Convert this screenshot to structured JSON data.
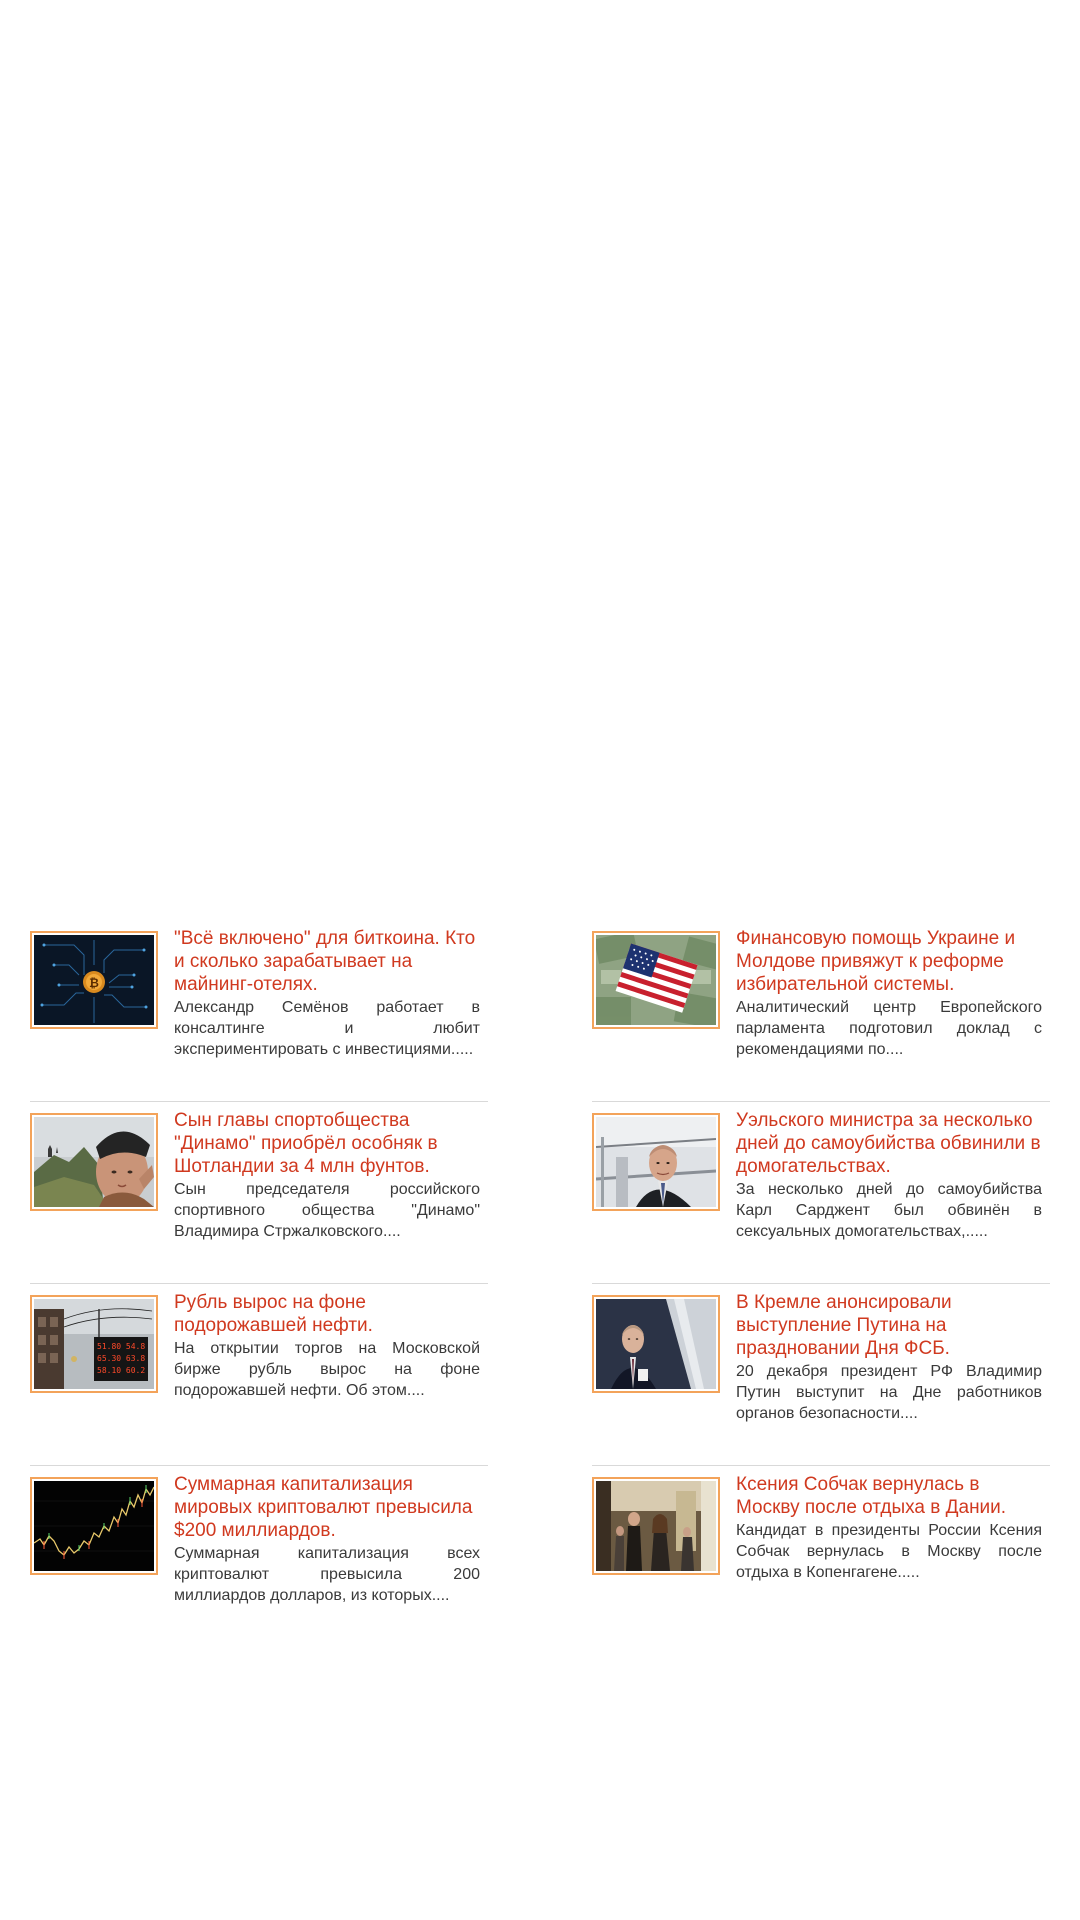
{
  "articles": [
    {
      "title": "\"Всё включено\" для биткоина. Кто и сколько зарабатывает на майнинг-отелях.",
      "excerpt": "Александр Семёнов работает в консалтинге и любит экспериментировать с инвестициями.....",
      "image": "bitcoin-circuit-image"
    },
    {
      "title": "Финансовую помощь Украине и Молдове привяжут к реформе избирательной системы.",
      "excerpt": "Аналитический центр Европейского парламента подготовил доклад с рекомендациями по....",
      "image": "us-flag-dollars-image"
    },
    {
      "title": "Сын главы спортобщества \"Динамо\" приобрёл особняк в Шотландии за 4 млн фунтов.",
      "excerpt": "Сын председателя российского спортивного общества \"Динамо\" Владимира Стржалковского....",
      "image": "scottish-landscape-image"
    },
    {
      "title": "Уэльского министра за несколько дней до самоубийства обвинили в домогательствах.",
      "excerpt": "За несколько дней до самоубийства Карл Сарджент был обвинён в сексуальных домогательствах,.....",
      "image": "minister-portrait-image"
    },
    {
      "title": "Рубль вырос на фоне подорожавшей нефти.",
      "excerpt": "На открытии торгов на Московской бирже рубль вырос на фоне подорожавшей нефти. Об этом....",
      "image": "exchange-board-image"
    },
    {
      "title": "В Кремле анонсировали выступление Путина на праздновании Дня ФСБ.",
      "excerpt": "20 декабря президент РФ Владимир Путин выступит на Дне работников органов безопасности....",
      "image": "putin-podium-image"
    },
    {
      "title": "Суммарная капитализация мировых криптовалют превысила $200 миллиардов.",
      "excerpt": "Суммарная капитализация всех криптовалют превысила 200 миллиардов долларов, из которых....",
      "image": "crypto-chart-image"
    },
    {
      "title": "Ксения Собчак вернулась в Москву после отдыха в Дании.",
      "excerpt": "Кандидат в президенты России Ксения Собчак вернулась в Москву после отдыха в Копенгагене.....",
      "image": "airport-arrival-image"
    }
  ],
  "colors": {
    "headline": "#d0391f",
    "thumb_border": "#f3a35a",
    "divider": "#d9d9d9",
    "excerpt": "#3a3a3a"
  }
}
